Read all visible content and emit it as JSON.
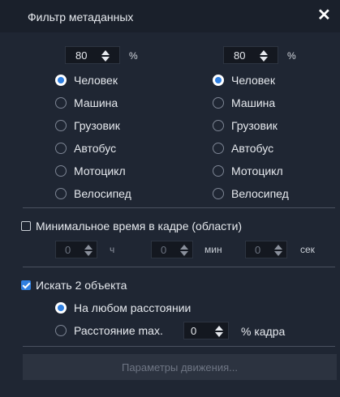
{
  "dialog": {
    "title": "Фильтр метаданных",
    "close_icon": "close-icon"
  },
  "threshold": {
    "left": {
      "value": "80",
      "unit": "%"
    },
    "right": {
      "value": "80",
      "unit": "%"
    }
  },
  "objects_left": [
    {
      "label": "Человек",
      "selected": true
    },
    {
      "label": "Машина",
      "selected": false
    },
    {
      "label": "Грузовик",
      "selected": false
    },
    {
      "label": "Автобус",
      "selected": false
    },
    {
      "label": "Мотоцикл",
      "selected": false
    },
    {
      "label": "Велосипед",
      "selected": false
    }
  ],
  "objects_right": [
    {
      "label": "Человек",
      "selected": true
    },
    {
      "label": "Машина",
      "selected": false
    },
    {
      "label": "Грузовик",
      "selected": false
    },
    {
      "label": "Автобус",
      "selected": false
    },
    {
      "label": "Мотоцикл",
      "selected": false
    },
    {
      "label": "Велосипед",
      "selected": false
    }
  ],
  "min_time": {
    "label": "Минимальное время в кадре (области)",
    "checked": false,
    "hours": {
      "value": "0",
      "unit": "ч"
    },
    "minutes": {
      "value": "0",
      "unit": "мин"
    },
    "seconds": {
      "value": "0",
      "unit": "сек"
    }
  },
  "search_two": {
    "label": "Искать 2 объекта",
    "checked": true,
    "option_any": "На любом расстоянии",
    "option_max": "Расстояние max.",
    "max_value": "0",
    "max_unit": "% кадра"
  },
  "motion_button": "Параметры движения...",
  "colors": {
    "background": "#1f2633",
    "accent": "#2f7fe0",
    "input_bg": "#141820"
  }
}
